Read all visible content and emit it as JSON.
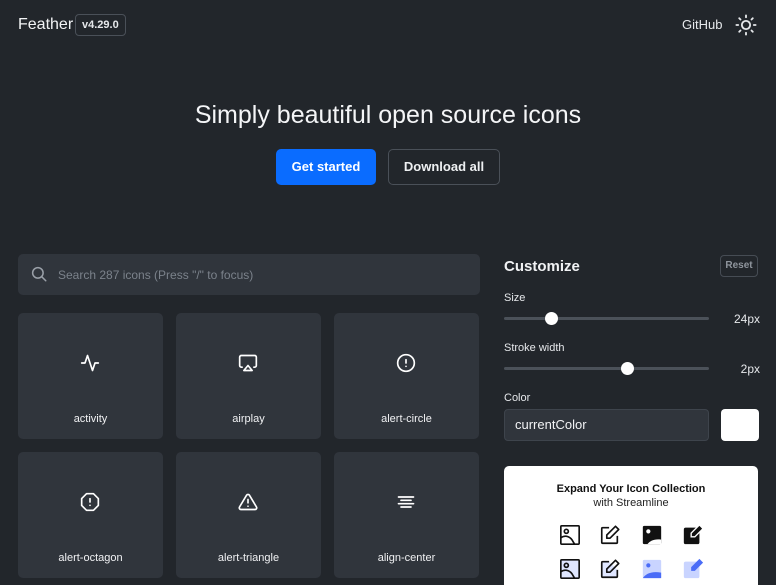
{
  "header": {
    "brand": "Feather",
    "version": "v4.29.0",
    "github": "GitHub",
    "theme_icon": "sun-icon"
  },
  "hero": {
    "title": "Simply beautiful open source icons",
    "primary_label": "Get started",
    "secondary_label": "Download all"
  },
  "search": {
    "placeholder": "Search 287 icons (Press \"/\" to focus)",
    "value": ""
  },
  "icons": [
    {
      "name": "activity"
    },
    {
      "name": "airplay"
    },
    {
      "name": "alert-circle"
    },
    {
      "name": "alert-octagon"
    },
    {
      "name": "alert-triangle"
    },
    {
      "name": "align-center"
    }
  ],
  "customize": {
    "title": "Customize",
    "reset_label": "Reset",
    "size": {
      "label": "Size",
      "value": 24,
      "min": 12,
      "max": 64,
      "display": "24px"
    },
    "stroke": {
      "label": "Stroke width",
      "value": 2,
      "min": 0.5,
      "max": 3,
      "display": "2px"
    },
    "color": {
      "label": "Color",
      "value": "currentColor",
      "swatch": "#ffffff"
    }
  },
  "promo": {
    "title": "Expand Your Icon Collection",
    "subtitle": "with Streamline"
  },
  "colors": {
    "background": "#22262b",
    "surface": "#30353c",
    "accent": "#0a6cff",
    "promo_blue": "#4a6cf7"
  }
}
